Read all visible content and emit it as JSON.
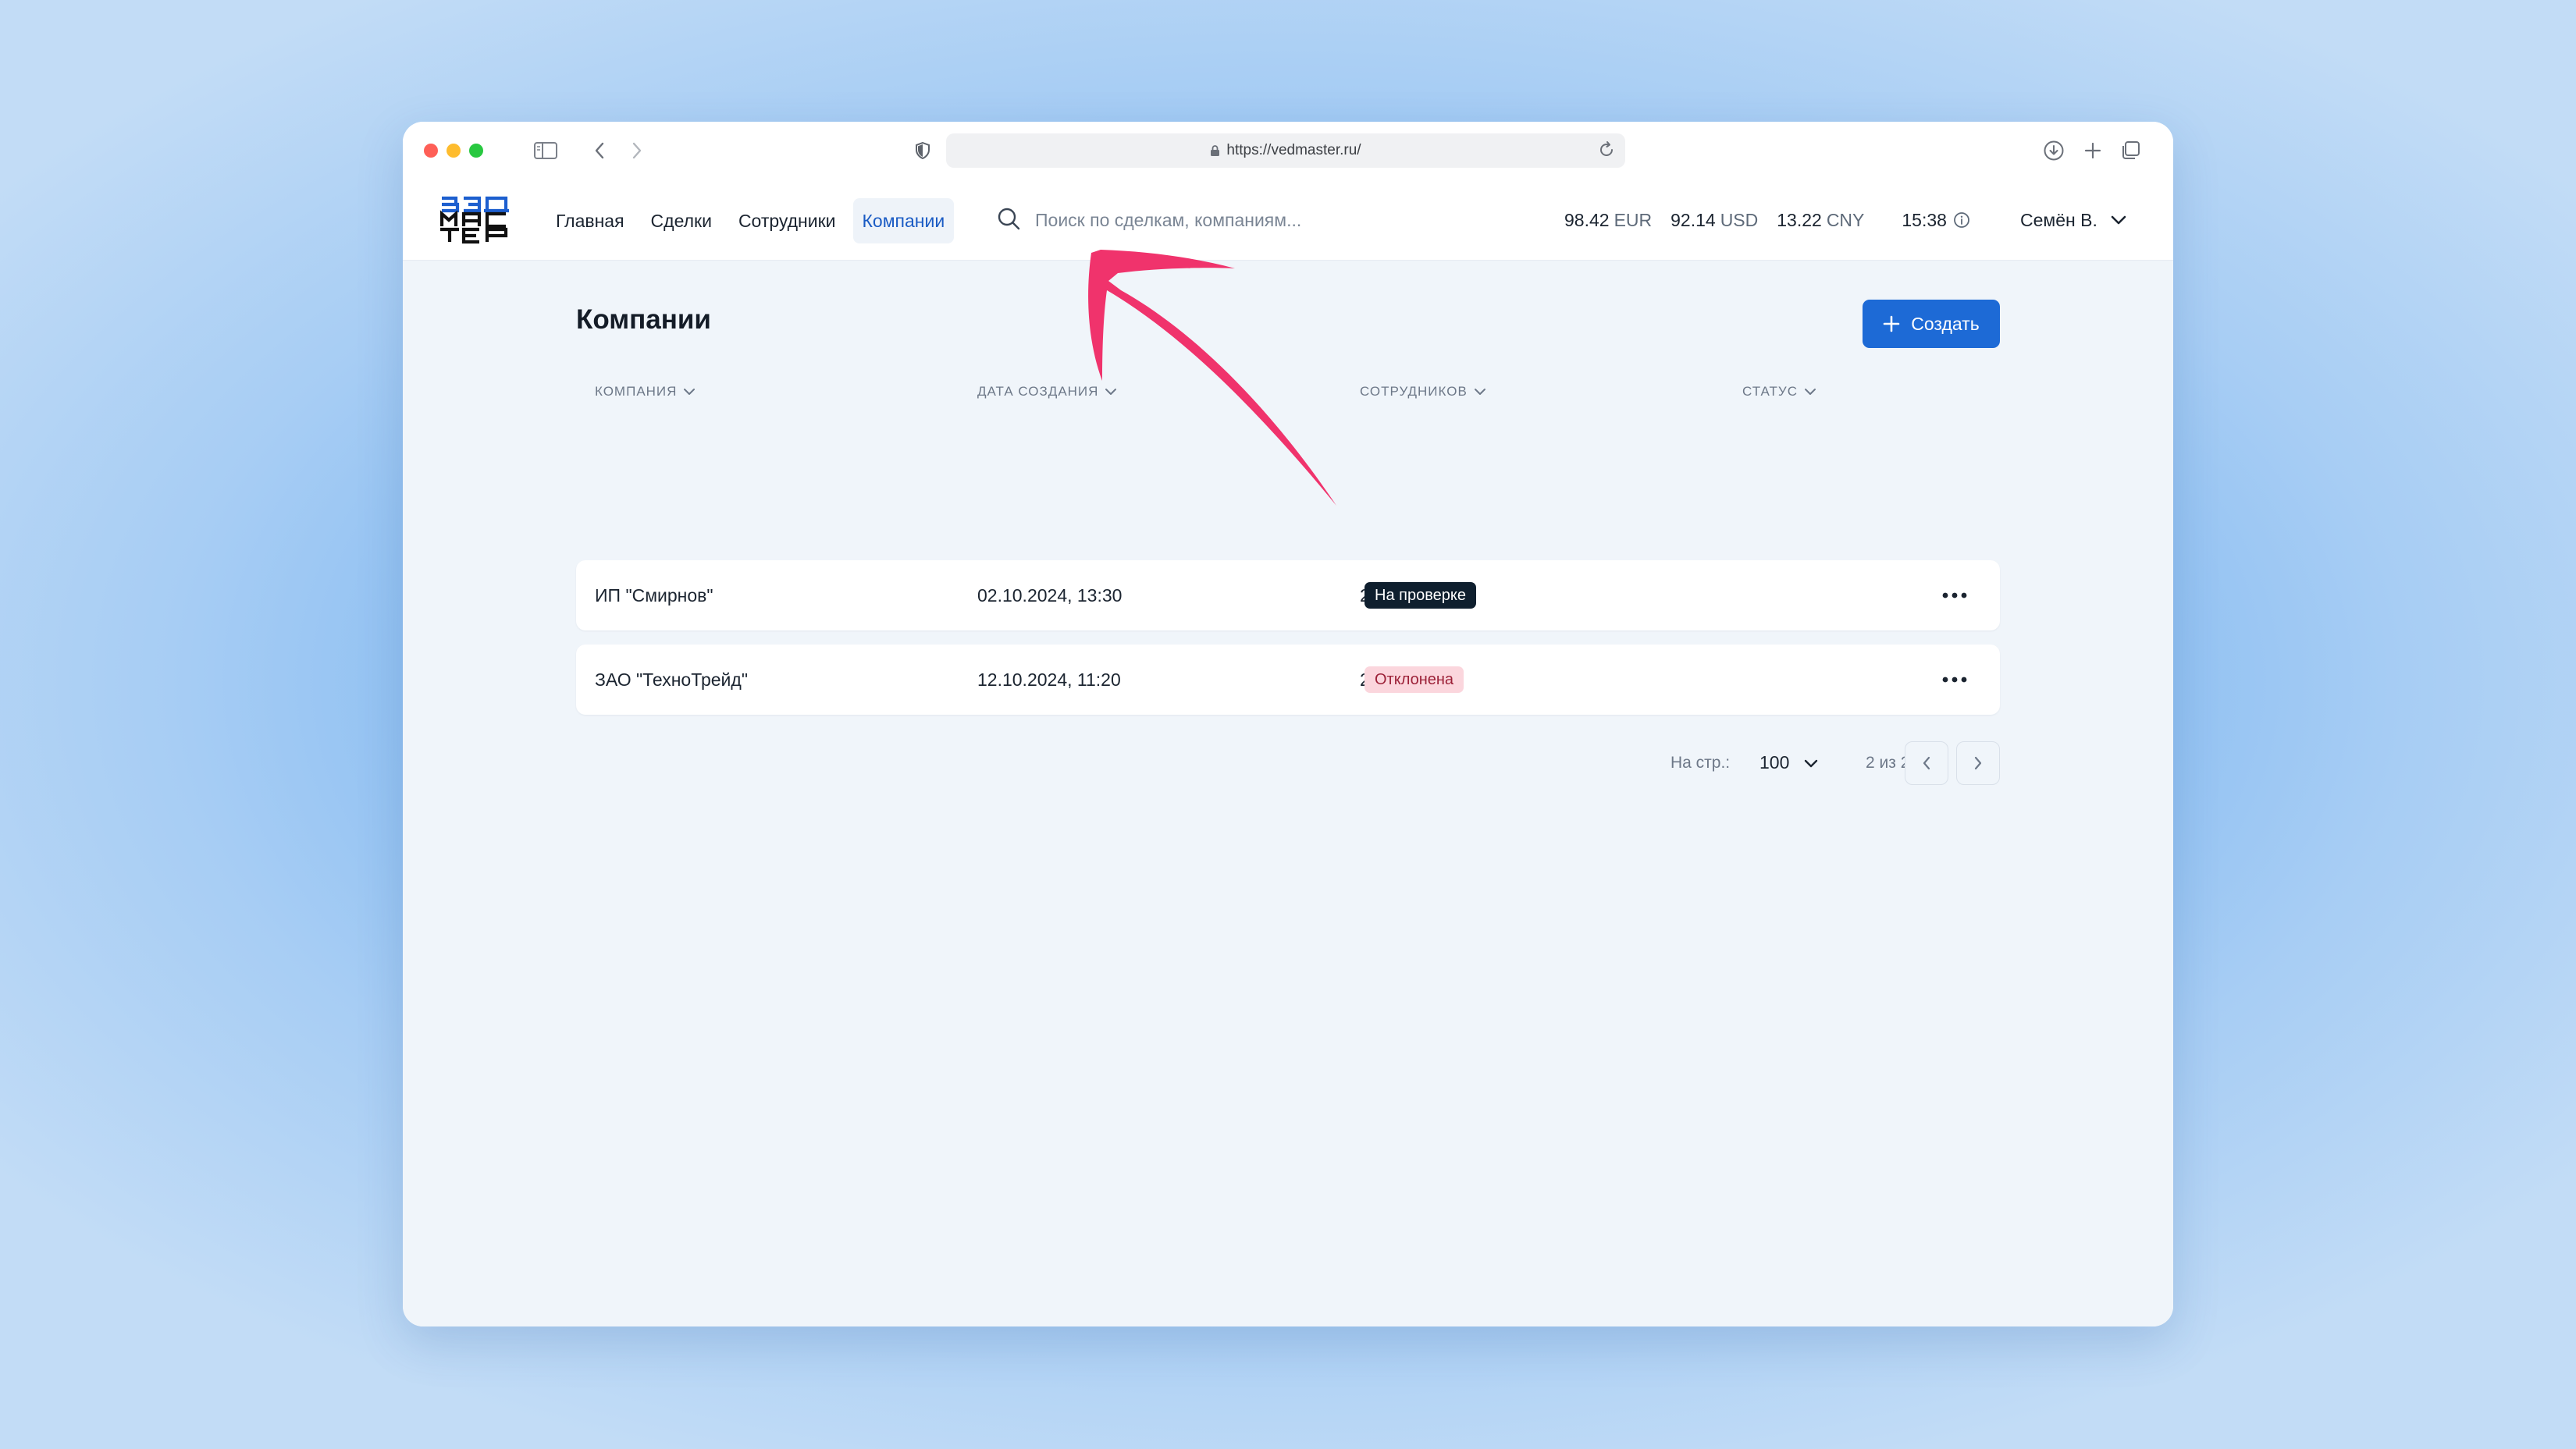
{
  "browser": {
    "url": "https://vedmaster.ru/"
  },
  "app": {
    "logo": {
      "lines": [
        "ВЭД",
        "МАС",
        "ТЕР"
      ]
    },
    "nav": [
      {
        "label": "Главная",
        "active": false
      },
      {
        "label": "Сделки",
        "active": false
      },
      {
        "label": "Сотрудники",
        "active": false
      },
      {
        "label": "Компании",
        "active": true
      }
    ],
    "search": {
      "placeholder": "Поиск по сделкам, компаниям..."
    },
    "rates": [
      {
        "value": "98.42",
        "currency": "EUR"
      },
      {
        "value": "92.14",
        "currency": "USD"
      },
      {
        "value": "13.22",
        "currency": "CNY"
      }
    ],
    "time": "15:38",
    "user": "Семён В."
  },
  "main": {
    "title": "Компании",
    "create_label": "Создать",
    "columns": [
      "Компания",
      "Дата создания",
      "Сотрудников",
      "Статус"
    ],
    "rows": [
      {
        "company": "ИП \"Смирнов\"",
        "created": "02.10.2024, 13:30",
        "employees": "2",
        "status": "На проверке",
        "status_style": "dark"
      },
      {
        "company": "ЗАО \"ТехноТрейд\"",
        "created": "12.10.2024, 11:20",
        "employees": "2",
        "status": "Отклонена",
        "status_style": "pink"
      }
    ],
    "pagination": {
      "per_page_label": "На стр.:",
      "per_page": "100",
      "range": "2 из 2"
    }
  },
  "colors": {
    "accent": "#1d6ad6",
    "annotation_arrow": "#f0336c",
    "badge_dark": "#0f1f2e",
    "badge_pink": "#fbd6dd"
  }
}
